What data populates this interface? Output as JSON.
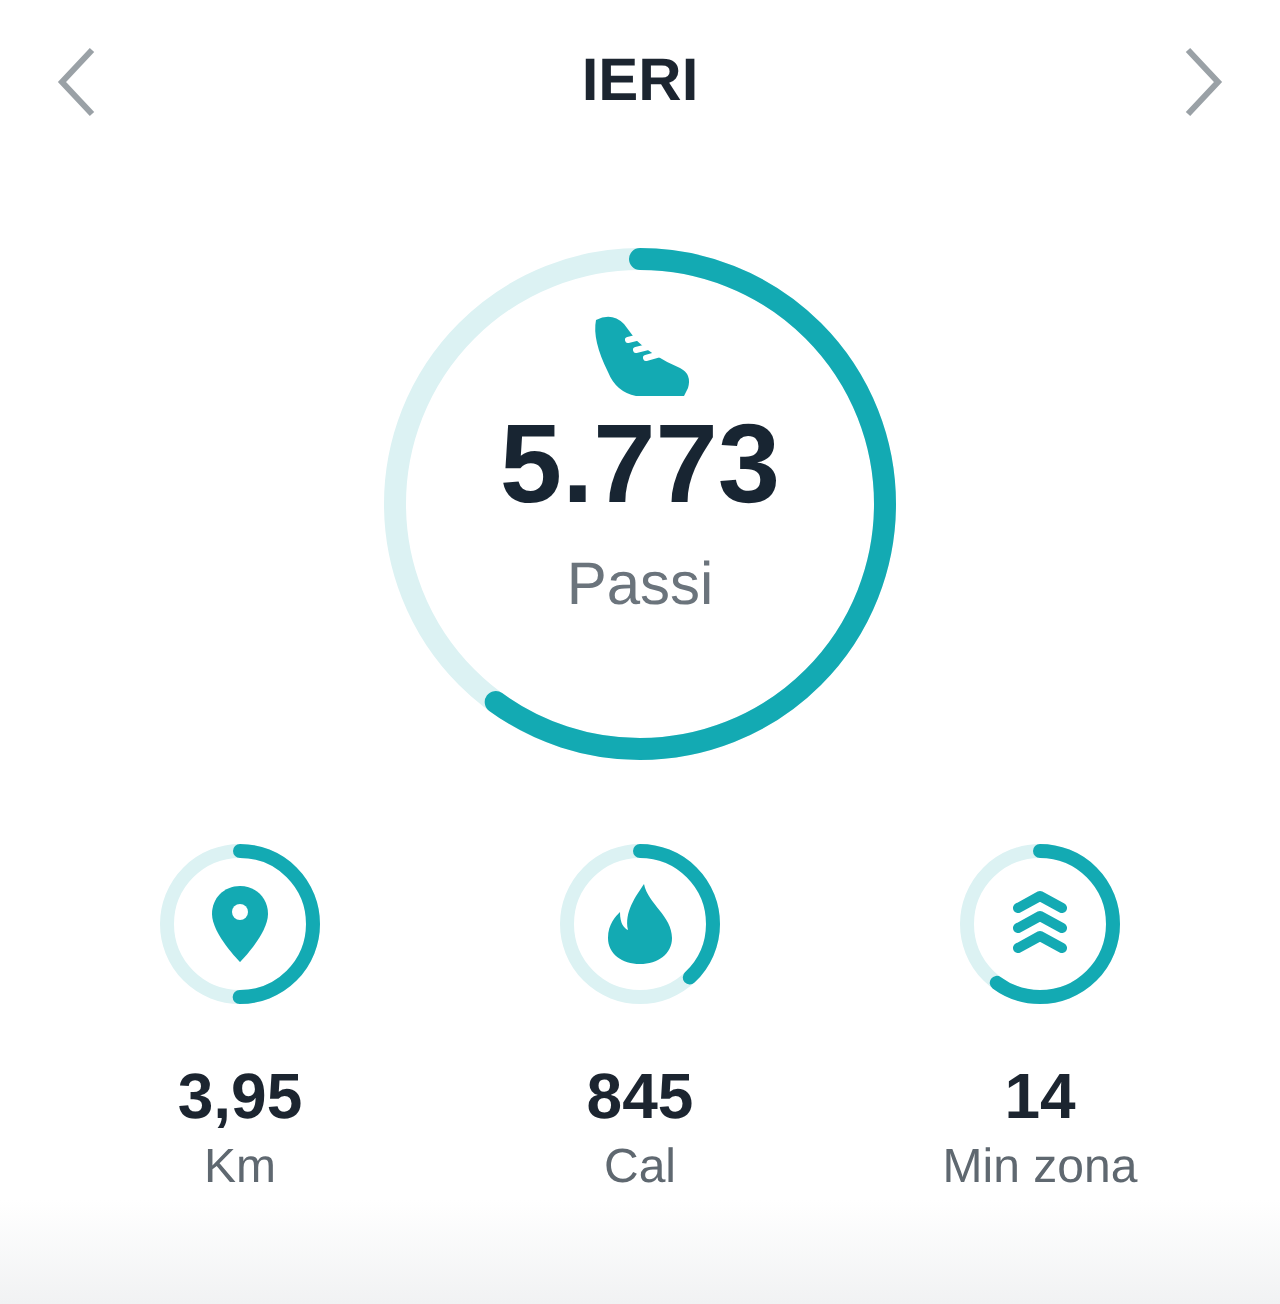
{
  "header": {
    "title": "IERI"
  },
  "main": {
    "kind": "steps",
    "value": "5.773",
    "label": "Passi",
    "level": 0.6
  },
  "stats": [
    {
      "kind": "distance",
      "value": "3,95",
      "label": "Km",
      "level": 0.5
    },
    {
      "kind": "calories",
      "value": "845",
      "label": "Cal",
      "level": 0.38
    },
    {
      "kind": "zone",
      "value": "14",
      "label": "Min zona",
      "level": 0.6
    }
  ]
}
